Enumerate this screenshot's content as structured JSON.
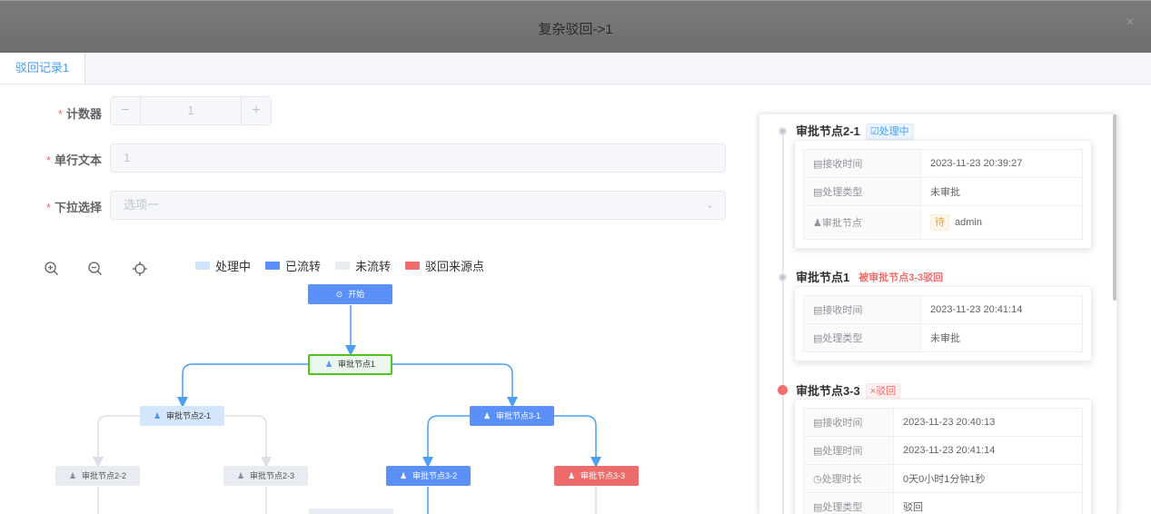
{
  "dialog": {
    "title": "复杂驳回->1",
    "close": "×"
  },
  "tabs": [
    {
      "label": "驳回记录1"
    }
  ],
  "form": {
    "counter": {
      "label": "计数器",
      "required": "*",
      "value": "1",
      "minus": "−",
      "plus": "+"
    },
    "text": {
      "label": "单行文本",
      "required": "*",
      "value": "1"
    },
    "select": {
      "label": "下拉选择",
      "required": "*",
      "placeholder": "选项一",
      "arrow": "⌄"
    }
  },
  "flow": {
    "toolbar": [
      {
        "name": "zoom-in-icon"
      },
      {
        "name": "zoom-out-icon"
      },
      {
        "name": "locate-icon"
      }
    ],
    "legend": [
      {
        "label": "处理中",
        "color": "#cfe4fb"
      },
      {
        "label": "已流转",
        "color": "#5b8ff9"
      },
      {
        "label": "未流转",
        "color": "#e8ebf2"
      },
      {
        "label": "驳回来源点",
        "color": "#ef6c6c"
      }
    ],
    "nodes": {
      "start": "开始",
      "n1": "审批节点1",
      "n21": "审批节点2-1",
      "n31": "审批节点3-1",
      "n22": "审批节点2-2",
      "n23": "审批节点2-3",
      "n32": "审批节点3-2",
      "n33": "审批节点3-3"
    }
  },
  "timeline": [
    {
      "title": "审批节点2-1",
      "tag": "☑处理中",
      "rows": [
        {
          "key": "▤接收时间",
          "value": "2023-11-23 20:39:27"
        },
        {
          "key": "▤处理类型",
          "value": "未审批"
        },
        {
          "key": "♟审批节点",
          "badge": "待",
          "value": "admin"
        }
      ]
    },
    {
      "title": "审批节点1",
      "tag": "被审批节点3-3驳回",
      "rows": [
        {
          "key": "▤接收时间",
          "value": "2023-11-23 20:41:14"
        },
        {
          "key": "▤处理类型",
          "value": "未审批"
        }
      ]
    },
    {
      "title": "审批节点3-3",
      "tag": "×驳回",
      "rows": [
        {
          "key": "▤接收时间",
          "value": "2023-11-23 20:40:13"
        },
        {
          "key": "▤处理时间",
          "value": "2023-11-23 20:41:14"
        },
        {
          "key": "◷处理时长",
          "value": "0天0小时1分钟1秒"
        },
        {
          "key": "▤处理类型",
          "value": "驳回"
        }
      ]
    }
  ]
}
